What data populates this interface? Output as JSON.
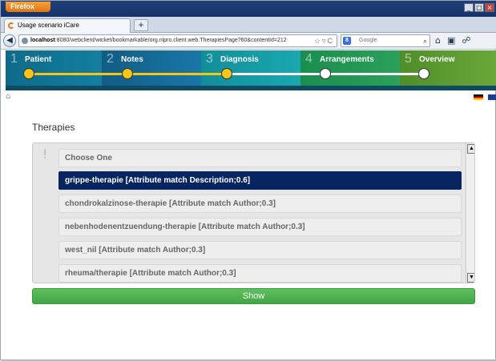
{
  "browser": {
    "app_button": "Firefox",
    "tab_title": "Usage scenario iCare",
    "url_host": "localhost",
    "url_rest": ":8080/webclient/wicket/bookmarkable/org.nipro.client.web.TherapiesPage?60&contentId=212",
    "search_placeholder": "Google"
  },
  "steps": [
    {
      "num": "1",
      "label": "Patient"
    },
    {
      "num": "2",
      "label": "Notes"
    },
    {
      "num": "3",
      "label": "Diagnosis"
    },
    {
      "num": "4",
      "label": "Arrangements"
    },
    {
      "num": "5",
      "label": "Overview"
    }
  ],
  "colors": {
    "completed_track": "#f5c518",
    "pending_track": "#ffffff",
    "selected_option": "#072560",
    "show_button": "#4cae4c"
  },
  "page": {
    "title": "Therapies",
    "info_mark": "!",
    "options": [
      {
        "label": "Choose One",
        "selected": false
      },
      {
        "label": "grippe-therapie [Attribute match Description;0.6]",
        "selected": true
      },
      {
        "label": "chondrokalzinose-therapie [Attribute match Author;0.3]",
        "selected": false
      },
      {
        "label": "nebenhodenentzuendung-therapie [Attribute match Author;0.3]",
        "selected": false
      },
      {
        "label": "west_nil [Attribute match Author;0.3]",
        "selected": false
      },
      {
        "label": "rheuma/therapie [Attribute match Author;0.3]",
        "selected": false
      }
    ],
    "show_button": "Show"
  }
}
